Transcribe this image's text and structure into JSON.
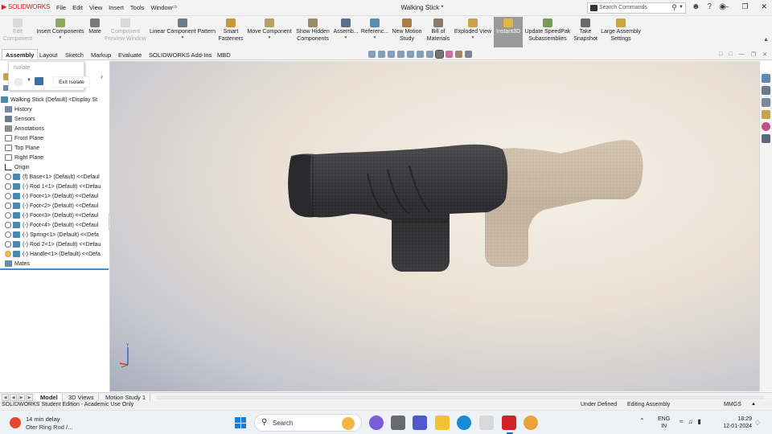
{
  "app": {
    "logo": "SOLIDWORKS",
    "menu": [
      "File",
      "Edit",
      "View",
      "Insert",
      "Tools",
      "Window"
    ],
    "document_title": "Walking Stick *",
    "search_placeholder": "Search Commands"
  },
  "ribbon": {
    "buttons": [
      {
        "label": "Edit\nComponent",
        "disabled": true,
        "icon": "edit-component-icon"
      },
      {
        "label": "Insert Components",
        "disabled": false,
        "icon": "insert-components-icon",
        "dropdown": true
      },
      {
        "label": "Mate",
        "disabled": false,
        "icon": "mate-icon"
      },
      {
        "label": "Component\nPreview Window",
        "disabled": true,
        "icon": "component-preview-icon"
      },
      {
        "label": "Linear Component Pattern",
        "disabled": false,
        "icon": "linear-pattern-icon",
        "dropdown": true
      },
      {
        "label": "Smart\nFasteners",
        "disabled": false,
        "icon": "smart-fasteners-icon"
      },
      {
        "label": "Move Component",
        "disabled": false,
        "icon": "move-component-icon",
        "dropdown": true
      },
      {
        "label": "Show Hidden\nComponents",
        "disabled": false,
        "icon": "show-hidden-icon"
      },
      {
        "label": "Assemb...",
        "disabled": false,
        "icon": "assembly-features-icon",
        "dropdown": true
      },
      {
        "label": "Referenc...",
        "disabled": false,
        "icon": "reference-geometry-icon",
        "dropdown": true
      },
      {
        "label": "New Motion\nStudy",
        "disabled": false,
        "icon": "motion-study-icon"
      },
      {
        "label": "Bill of\nMaterials",
        "disabled": false,
        "icon": "bom-icon"
      },
      {
        "label": "Exploded View",
        "disabled": false,
        "icon": "exploded-view-icon",
        "dropdown": true
      },
      {
        "label": "Instant3D",
        "disabled": false,
        "active": true,
        "icon": "instant3d-icon"
      },
      {
        "label": "Update SpeedPak\nSubassemblies",
        "disabled": false,
        "icon": "speedpak-icon"
      },
      {
        "label": "Take\nSnapshot",
        "disabled": false,
        "icon": "snapshot-icon"
      },
      {
        "label": "Large Assembly\nSettings",
        "disabled": false,
        "icon": "large-assembly-icon"
      }
    ]
  },
  "command_tabs": [
    "Assembly",
    "Layout",
    "Sketch",
    "Markup",
    "Evaluate",
    "SOLIDWORKS Add-Ins",
    "MBD"
  ],
  "isolate_popup": {
    "title": "Isolate",
    "exit_label": "Exit Isolate"
  },
  "feature_tree": {
    "items": [
      {
        "label": "Walking Stick (Default) <Display St",
        "icon": "assembly-icon"
      },
      {
        "label": "History",
        "icon": "history-icon"
      },
      {
        "label": "Sensors",
        "icon": "sensors-icon"
      },
      {
        "label": "Annotations",
        "icon": "annotations-icon"
      },
      {
        "label": "Front Plane",
        "icon": "plane-icon"
      },
      {
        "label": "Top Plane",
        "icon": "plane-icon"
      },
      {
        "label": "Right Plane",
        "icon": "plane-icon"
      },
      {
        "label": "Origin",
        "icon": "origin-icon"
      },
      {
        "label": "(f) Base<1> (Default) <<Defaul",
        "icon": "part-icon"
      },
      {
        "label": "(-) Rod 1<1> (Default) <<Defau",
        "icon": "part-icon"
      },
      {
        "label": "(-) Foot<1> (Default) <<Defaul",
        "icon": "part-icon"
      },
      {
        "label": "(-) Foot<2> (Default) <<Defaul",
        "icon": "part-icon"
      },
      {
        "label": "(-) Foot<3> (Default) <<Defaul",
        "icon": "part-icon"
      },
      {
        "label": "(-) Foot<4> (Default) <<Defaul",
        "icon": "part-icon"
      },
      {
        "label": "(-) Spring<1> (Default) <<Defa",
        "icon": "part-icon"
      },
      {
        "label": "(-) Rod 2<1> (Default) <<Defau",
        "icon": "part-icon"
      },
      {
        "label": "(-) Handle<1> (Default) <<Defa",
        "icon": "part-icon"
      },
      {
        "label": "Mates",
        "icon": "mates-icon"
      }
    ]
  },
  "bottom_tabs": [
    "Model",
    "3D Views",
    "Motion Study 1"
  ],
  "status_bar": {
    "edition": "SOLIDWORKS Student Edition - Academic Use Only",
    "state": "Under Defined",
    "mode": "Editing Assembly",
    "units": "MMGS"
  },
  "taskbar": {
    "weather_title": "14 min delay",
    "weather_sub": "Oter Ring Rod /...",
    "search_label": "Search",
    "lang_1": "ENG",
    "lang_2": "IN",
    "time": "18:29",
    "date": "12-01-2024"
  },
  "colors": {
    "brand_red": "#d2232a",
    "accent_blue": "#3a8fd6",
    "part_dark": "#3a3a3c",
    "part_ghost": "#cbbba6"
  }
}
